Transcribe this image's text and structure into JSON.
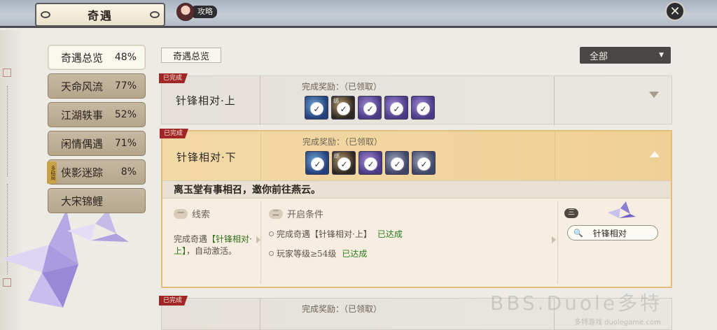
{
  "header": {
    "title": "奇遇",
    "guide_label": "攻略"
  },
  "sidebar": {
    "items": [
      {
        "label": "奇遇总览",
        "pct": "48%",
        "active": true
      },
      {
        "label": "天命风流",
        "pct": "77%"
      },
      {
        "label": "江湖轶事",
        "pct": "52%"
      },
      {
        "label": "闲情偶遇",
        "pct": "71%"
      },
      {
        "label": "侠影迷踪",
        "pct": "8%",
        "badge": "多结局"
      },
      {
        "label": "大宋锦鲤",
        "pct": ""
      }
    ]
  },
  "main": {
    "heading": "奇遇总览",
    "filter_value": "全部",
    "quests": [
      {
        "status": "已完成",
        "name": "针锋相对·上",
        "reward_label": "完成奖励：（已领取）",
        "rewards": [
          "blue",
          "bag",
          "purple",
          "purple",
          "purple"
        ],
        "reward_tag": "绑"
      },
      {
        "status": "已完成",
        "name": "针锋相对·下",
        "reward_label": "完成奖励：（已领取）",
        "rewards": [
          "blue",
          "bag",
          "purple",
          "slate",
          "slate"
        ],
        "reward_tag": "绑",
        "description": "离玉堂有事相召，邀你前往燕云。",
        "clue": {
          "num": "一",
          "title": "线索",
          "text_before": "完成奇遇",
          "text_highlight": "【针锋相对·上】",
          "text_after": "，自动激活。"
        },
        "conditions": {
          "num": "二",
          "title": "开启条件",
          "items": [
            {
              "text": "完成奇遇【针锋相对·上】",
              "state": "已达成"
            },
            {
              "text": "玩家等级≥54级",
              "state": "已达成"
            }
          ]
        },
        "step3_num": "三",
        "search_text": "针锋相对"
      },
      {
        "status": "已完成",
        "name": "",
        "reward_label": "完成奖励：（已领取）"
      }
    ]
  },
  "icons": {
    "check": "✓",
    "close": "✕",
    "search": "🔍"
  },
  "watermark": {
    "text": "BBS.Duole多特",
    "sub": "多特游戏 duolegame.com"
  }
}
